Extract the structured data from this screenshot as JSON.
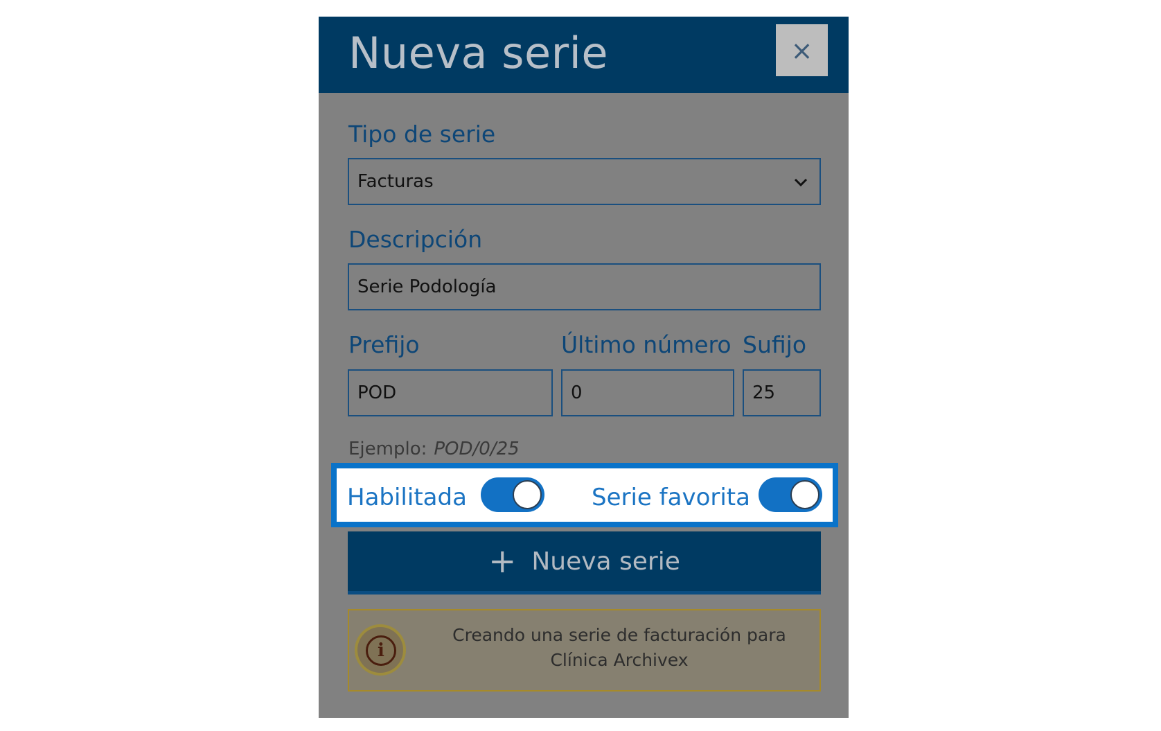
{
  "dialog": {
    "title": "Nueva serie",
    "close_label": "×"
  },
  "form": {
    "tipo": {
      "label": "Tipo de serie",
      "value": "Facturas"
    },
    "descripcion": {
      "label": "Descripción",
      "value": "Serie Podología"
    },
    "prefijo": {
      "label": "Prefijo",
      "value": "POD"
    },
    "ultimo_numero": {
      "label": "Último número",
      "value": "0"
    },
    "sufijo": {
      "label": "Sufijo",
      "value": "25"
    },
    "example": {
      "label": "Ejemplo:",
      "value": "POD/0/25"
    }
  },
  "toggles": {
    "habilitada": {
      "label": "Habilitada",
      "on": true
    },
    "favorita": {
      "label": "Serie favorita",
      "on": true
    }
  },
  "action": {
    "icon": "plus-icon",
    "label": "Nueva serie"
  },
  "info": {
    "icon": "info-icon",
    "text": "Creando una serie de facturación para Clínica Archivex"
  },
  "colors": {
    "header": "#003a62",
    "overlay": "#818181",
    "highlight": "#0a73c9",
    "toggle_on": "#1271c4"
  }
}
